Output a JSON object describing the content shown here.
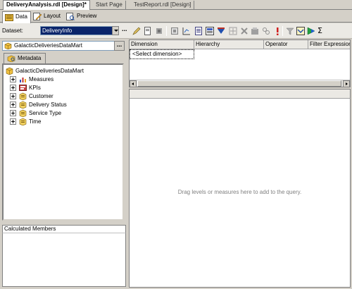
{
  "document_tabs": [
    {
      "label": "DeliveryAnalysis.rdl [Design]*",
      "active": true
    },
    {
      "label": "Start Page",
      "active": false
    },
    {
      "label": "TestReport.rdl [Design]",
      "active": false
    }
  ],
  "designer_tabs": [
    {
      "label": "Data",
      "icon": "data-icon",
      "active": true
    },
    {
      "label": "Layout",
      "icon": "layout-icon",
      "active": false
    },
    {
      "label": "Preview",
      "icon": "preview-icon",
      "active": false
    }
  ],
  "toolbar": {
    "dataset_label": "Dataset:",
    "dataset_value": "DeliveryInfo",
    "more_label": "...",
    "icons": [
      "edit-dataset-icon",
      "new-dataset-icon",
      "delete-dataset-icon",
      "refresh-fields-icon",
      "command-type-icon",
      "query-parameters-icon",
      "add-calculated-member-icon",
      "show-empty-cells-icon",
      "auto-execute-icon",
      "delete-icon",
      "prepare-query-icon",
      "cancel-query-icon",
      "query-parameters-icon",
      "design-mode-icon",
      "run-icon",
      "sum-icon"
    ],
    "sum_glyph": "Σ"
  },
  "metadata": {
    "cube_name": "GalacticDeliveriesDataMart",
    "browse_button": "...",
    "tab_label": "Metadata",
    "tree_root": "GalacticDeliveriesDataMart",
    "tree_items": [
      {
        "label": "Measures",
        "icon": "measures-icon"
      },
      {
        "label": "KPIs",
        "icon": "kpis-icon"
      },
      {
        "label": "Customer",
        "icon": "dimension-icon"
      },
      {
        "label": "Delivery Status",
        "icon": "dimension-icon"
      },
      {
        "label": "Service Type",
        "icon": "dimension-icon"
      },
      {
        "label": "Time",
        "icon": "dimension-icon"
      }
    ]
  },
  "calculated_members": {
    "label": "Calculated Members"
  },
  "filter_grid": {
    "columns": [
      "Dimension",
      "Hierarchy",
      "Operator",
      "Filter Expression"
    ],
    "placeholder_row": "<Select dimension>"
  },
  "query_pane": {
    "hint": "Drag levels or measures here to add to the query."
  }
}
